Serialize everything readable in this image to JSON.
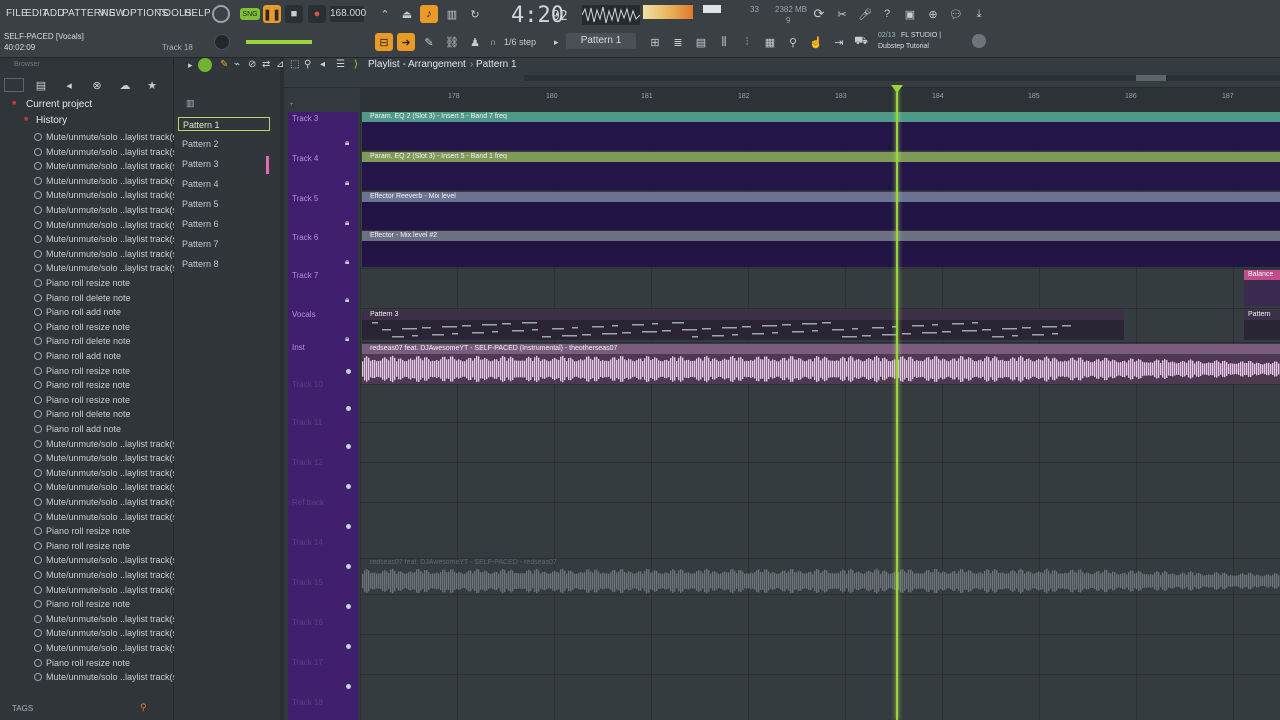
{
  "menu": [
    "FILE",
    "EDIT",
    "ADD",
    "PATTERNS",
    "VIEW",
    "OPTIONS",
    "TOOLS",
    "HELP"
  ],
  "project": {
    "name": "SELF-PACED [Vocals]",
    "time": "40:02:09",
    "track": "Track 18"
  },
  "transport": {
    "tempo": "168.000",
    "time_main": "4:20",
    "time_sub": "92",
    "cpu": "33",
    "mem": "2382 MB",
    "poly": "9"
  },
  "hint": {
    "counter": "02/13",
    "title": "FL STUDIO |",
    "subtitle": "Dubstep Tutorial"
  },
  "snap": "1/6 step",
  "pattern_selector": "Pattern 1",
  "browser": {
    "label": "Browser",
    "current_project": "Current project",
    "history_label": "History",
    "history_items": [
      "Mute/unmute/solo ..laylist track(s)",
      "Mute/unmute/solo ..laylist track(s)",
      "Mute/unmute/solo ..laylist track(s)",
      "Mute/unmute/solo ..laylist track(s)",
      "Mute/unmute/solo ..laylist track(s)",
      "Mute/unmute/solo ..laylist track(s)",
      "Mute/unmute/solo ..laylist track(s)",
      "Mute/unmute/solo ..laylist track(s)",
      "Mute/unmute/solo ..laylist track(s)",
      "Mute/unmute/solo ..laylist track(s)",
      "Piano roll resize note",
      "Piano roll delete note",
      "Piano roll add note",
      "Piano roll resize note",
      "Piano roll delete note",
      "Piano roll add note",
      "Piano roll resize note",
      "Piano roll resize note",
      "Piano roll resize note",
      "Piano roll delete note",
      "Piano roll add note",
      "Mute/unmute/solo ..laylist track(s)",
      "Mute/unmute/solo ..laylist track(s)",
      "Mute/unmute/solo ..laylist track(s)",
      "Mute/unmute/solo ..laylist track(s)",
      "Mute/unmute/solo ..laylist track(s)",
      "Mute/unmute/solo ..laylist track(s)",
      "Piano roll resize note",
      "Piano roll resize note",
      "Mute/unmute/solo ..laylist track(s)",
      "Mute/unmute/solo ..laylist track(s)",
      "Mute/unmute/solo ..laylist track(s)",
      "Piano roll resize note",
      "Mute/unmute/solo ..laylist track(s)",
      "Mute/unmute/solo ..laylist track(s)",
      "Mute/unmute/solo ..laylist track(s)",
      "Piano roll resize note",
      "Mute/unmute/solo ..laylist track(s)"
    ],
    "tags": "TAGS"
  },
  "patterns": [
    "Pattern 1",
    "Pattern 2",
    "Pattern 3",
    "Pattern 4",
    "Pattern 5",
    "Pattern 6",
    "Pattern 7",
    "Pattern 8"
  ],
  "playlist": {
    "title": "Playlist - Arrangement",
    "pattern": "Pattern 1",
    "ruler": [
      "178",
      "180",
      "181",
      "182",
      "183",
      "184",
      "185",
      "186",
      "187"
    ],
    "tracks": [
      "Track 3",
      "Track 4",
      "Track 5",
      "Track 6",
      "Track 7",
      "Vocals",
      "Inst",
      "Track 10",
      "Track 11",
      "Track 12",
      "Ref track",
      "Track 14",
      "Track 15",
      "Track 16",
      "Track 17",
      "Track 18"
    ],
    "clips": {
      "track3": "Param. EQ 2 (Slot 3) - Insert 5 - Band 7 freq",
      "track4": "Param. EQ 2 (Slot 3) - Insert 5 - Band 1 freq",
      "track5": "Effector Reeverb - Mix level",
      "track6": "Effector - Mix level #2",
      "track7": "Balance",
      "vocals": "Pattern 3",
      "vocals_right": "Pattern",
      "inst": "redseas07 feat. DJAwesomeYT - SELF-PACED (Instrumental) - theotherseas07",
      "ref": "redseas07 feat. DJAwesomeYT - SELF-PACED - redseas07"
    }
  },
  "colors": {
    "accent": "#e99a28",
    "playhead": "#9ad63a",
    "track_bg": "#40206e"
  }
}
